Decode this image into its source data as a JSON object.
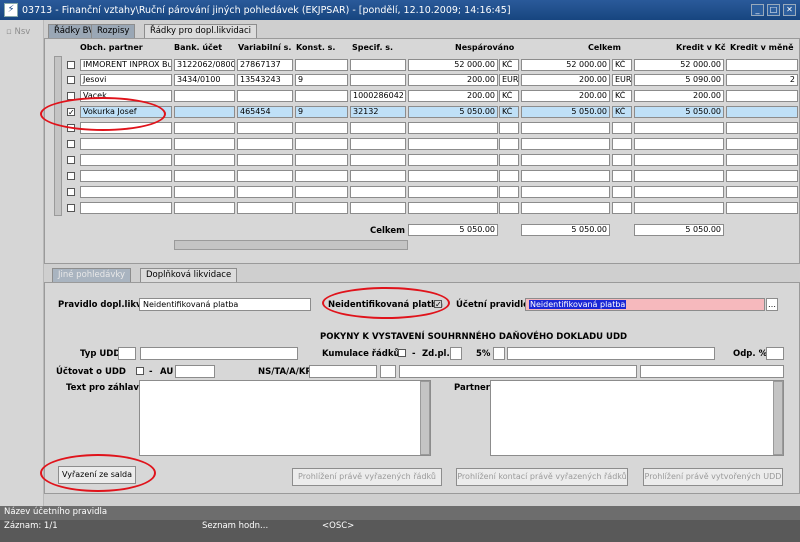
{
  "window": {
    "title": "03713 - Finanční vztahy\\Ruční párování jiných pohledávek (EKJPSAR) - [pondělí, 12.10.2009; 14:16:45]",
    "app_icon": "app-icon"
  },
  "left_rail": {
    "label": "Nsv"
  },
  "top_tabs": [
    "Řádky BV",
    "Rozpisy",
    "Řádky pro dopl.likvidaci"
  ],
  "grid": {
    "headers": [
      "Obch. partner",
      "Bank. účet",
      "Variabilní s.",
      "Konst. s.",
      "Specif. s.",
      "Nespárováno",
      "Celkem",
      "Kredit v Kč",
      "Kredit v měně"
    ],
    "rows": [
      {
        "checked": false,
        "partner": "IMMORENT INPROX Bu",
        "account": "3122062/0800",
        "vs": "27867137",
        "ks": "",
        "ss": "",
        "nesparovano": "52 000.00",
        "cur1": "KČ",
        "celkem": "52 000.00",
        "cur2": "KČ",
        "kredit_kc": "52 000.00",
        "kredit_mena": ""
      },
      {
        "checked": false,
        "partner": "Jesovi",
        "account": "3434/0100",
        "vs": "13543243",
        "ks": "9",
        "ss": "",
        "nesparovano": "200.00",
        "cur1": "EUR",
        "celkem": "200.00",
        "cur2": "EUR",
        "kredit_kc": "5 090.00",
        "kredit_mena": "2"
      },
      {
        "checked": false,
        "partner": "Vacek",
        "account": "",
        "vs": "",
        "ks": "",
        "ss": "1000286042",
        "nesparovano": "200.00",
        "cur1": "KČ",
        "celkem": "200.00",
        "cur2": "KČ",
        "kredit_kc": "200.00",
        "kredit_mena": ""
      },
      {
        "checked": true,
        "partner": "Vokurka Josef",
        "account": "",
        "vs": "465454",
        "ks": "9",
        "ss": "32132",
        "nesparovano": "5 050.00",
        "cur1": "KČ",
        "celkem": "5 050.00",
        "cur2": "KČ",
        "kredit_kc": "5 050.00",
        "kredit_mena": ""
      }
    ],
    "total_label": "Celkem",
    "totals": [
      "5 050.00",
      "5 050.00",
      "5 050.00"
    ]
  },
  "bottom_tabs": [
    "Jiné pohledávky",
    "Doplňková likvidace"
  ],
  "form": {
    "pravidlo_label": "Pravidlo dopl.likv.",
    "pravidlo_value": "Neidentifikovaná platba",
    "neident_label": "Neidentifikovaná platba",
    "ucetni_label": "Účetní pravidlo",
    "ucetni_value": "Neidentifikovaná platba",
    "section_title": "POKYNY K VYSTAVENÍ SOUHRNNÉHO DAŇOVÉHO DOKLADU UDD",
    "typ_udd": "Typ UDD",
    "kumulace": "Kumulace řádků",
    "zd_pl": "Zd.pl.",
    "pct": "5%",
    "odp": "Odp. %",
    "uctovat": "Účtovat o UDD",
    "au": "AU",
    "ns": "NS/TA/A/KP",
    "text_pro": "Text pro záhlaví",
    "partner": "Partner"
  },
  "buttons": {
    "vyrazeni": "Vyřazení ze salda",
    "prohlizeni1": "Prohlížení právě vyřazených řádků",
    "prohlizeni2": "Prohlížení kontací právě vyřazených řádků",
    "prohlizeni3": "Prohlížení právě vytvořených UDD"
  },
  "status": {
    "hint": "Název účetního pravidla",
    "record": "Záznam: 1/1",
    "list": "Seznam hodn...",
    "osc": "<OSC>"
  },
  "colors": {
    "selected_row": "#bfe0f7",
    "highlight_field": "#f6b9bd",
    "annotation": "#e0131b"
  }
}
